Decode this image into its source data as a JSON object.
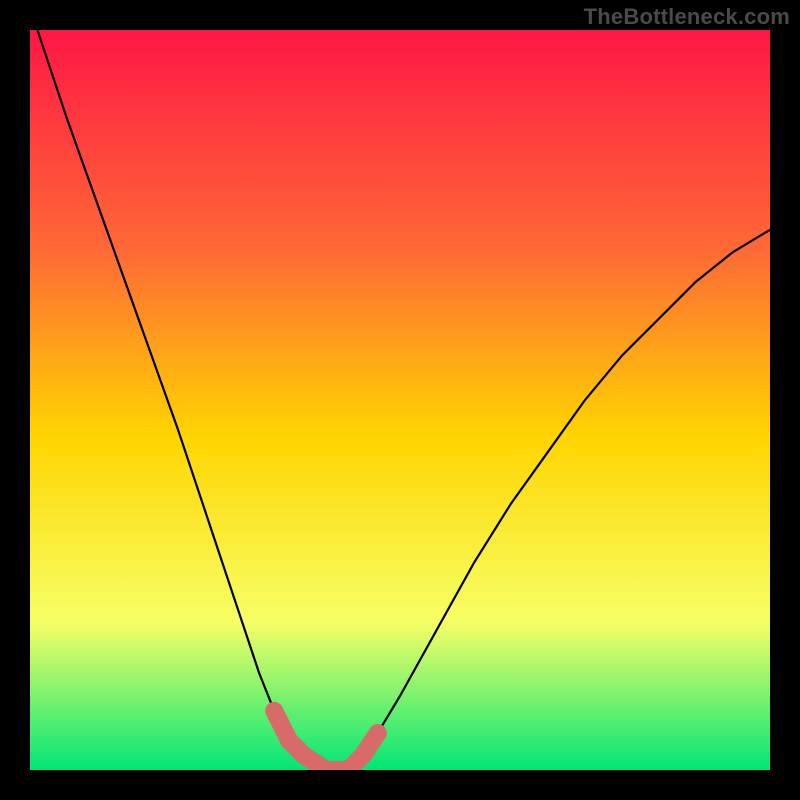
{
  "watermark": "TheBottleneck.com",
  "colors": {
    "gradient_top": "#ff1744",
    "gradient_mid_upper": "#ff6a36",
    "gradient_mid": "#ffd500",
    "gradient_mid_lower": "#f7ff66",
    "gradient_bottom": "#00e676",
    "curve": "#000000",
    "highlight": "#d96a6a",
    "frame": "#000000"
  },
  "chart_data": {
    "type": "line",
    "title": "",
    "xlabel": "",
    "ylabel": "",
    "xlim": [
      0,
      100
    ],
    "ylim": [
      0,
      100
    ],
    "series": [
      {
        "name": "bottleneck-curve",
        "x": [
          1,
          5,
          10,
          15,
          20,
          25,
          28,
          31,
          33,
          35,
          37,
          40,
          43,
          45,
          47,
          50,
          55,
          60,
          65,
          70,
          75,
          80,
          85,
          90,
          95,
          100
        ],
        "y": [
          100,
          88,
          74,
          60,
          46,
          31,
          22,
          13,
          8,
          4,
          2,
          0,
          0,
          2,
          5,
          10,
          19,
          28,
          36,
          43,
          50,
          56,
          61,
          66,
          70,
          73
        ]
      }
    ],
    "highlight_region": {
      "name": "optimal-zone",
      "x_start": 33,
      "x_end": 47,
      "y_max": 9
    }
  }
}
